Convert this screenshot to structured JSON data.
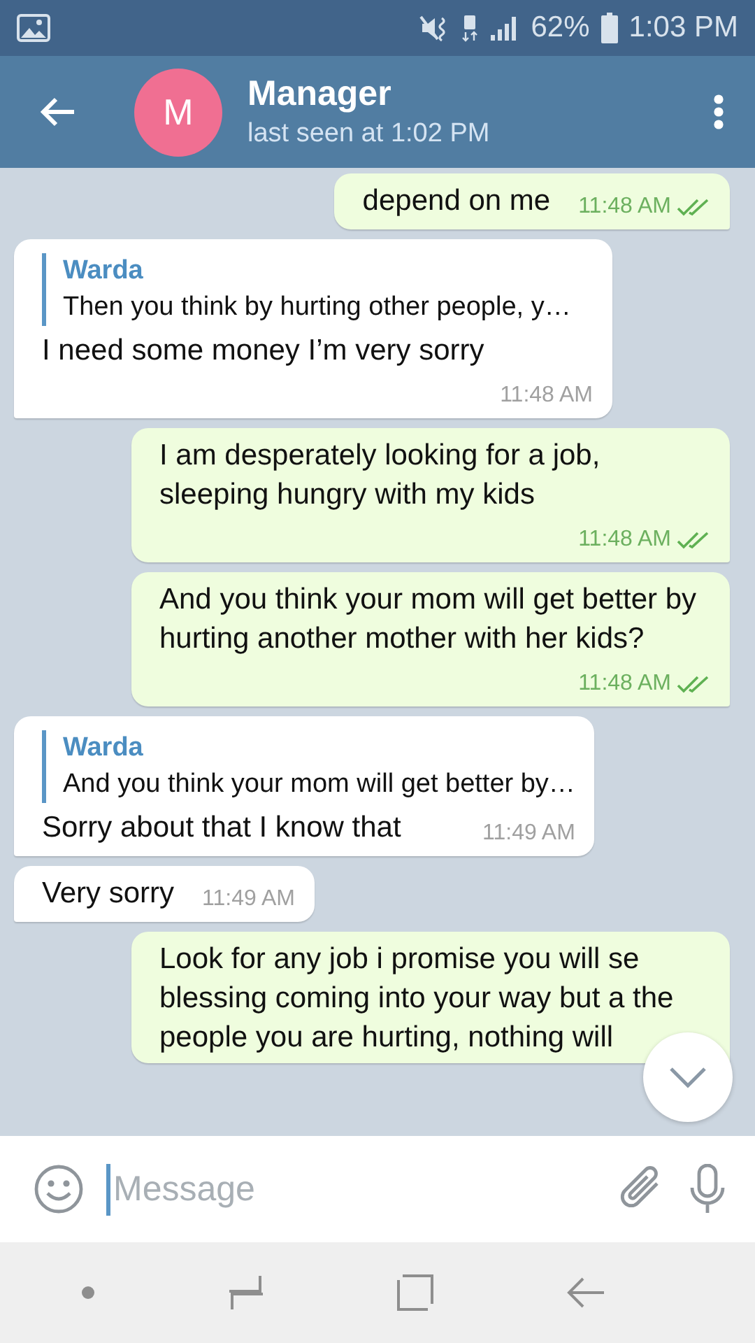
{
  "status_bar": {
    "battery": "62%",
    "time": "1:03 PM"
  },
  "header": {
    "avatar_letter": "M",
    "name": "Manager",
    "status": "last seen at 1:02 PM"
  },
  "messages": [
    {
      "kind": "outgoing",
      "text": "depend on me",
      "time": "11:48 AM",
      "read": true
    },
    {
      "kind": "incoming",
      "reply": {
        "name": "Warda",
        "text": "Then you think by hurting other people, y…"
      },
      "text": "I need some money I’m very sorry",
      "time": "11:48 AM"
    },
    {
      "kind": "outgoing",
      "text": "I am desperately looking for a job, sleeping hungry with my kids",
      "time": "11:48 AM",
      "read": true
    },
    {
      "kind": "outgoing",
      "text": "And you think your mom will get better by hurting another mother with her kids?",
      "time": "11:48 AM",
      "read": true
    },
    {
      "kind": "incoming",
      "reply": {
        "name": "Warda",
        "text": "And you think your mom will get better by…"
      },
      "text": "Sorry about that I know that",
      "time": "11:49 AM"
    },
    {
      "kind": "incoming",
      "text": "Very sorry",
      "time": "11:49 AM"
    },
    {
      "kind": "outgoing",
      "text": "Look for any job i promise you will se blessing coming into your way but a the people you are hurting, nothing will"
    }
  ],
  "composer": {
    "placeholder": "Message"
  }
}
